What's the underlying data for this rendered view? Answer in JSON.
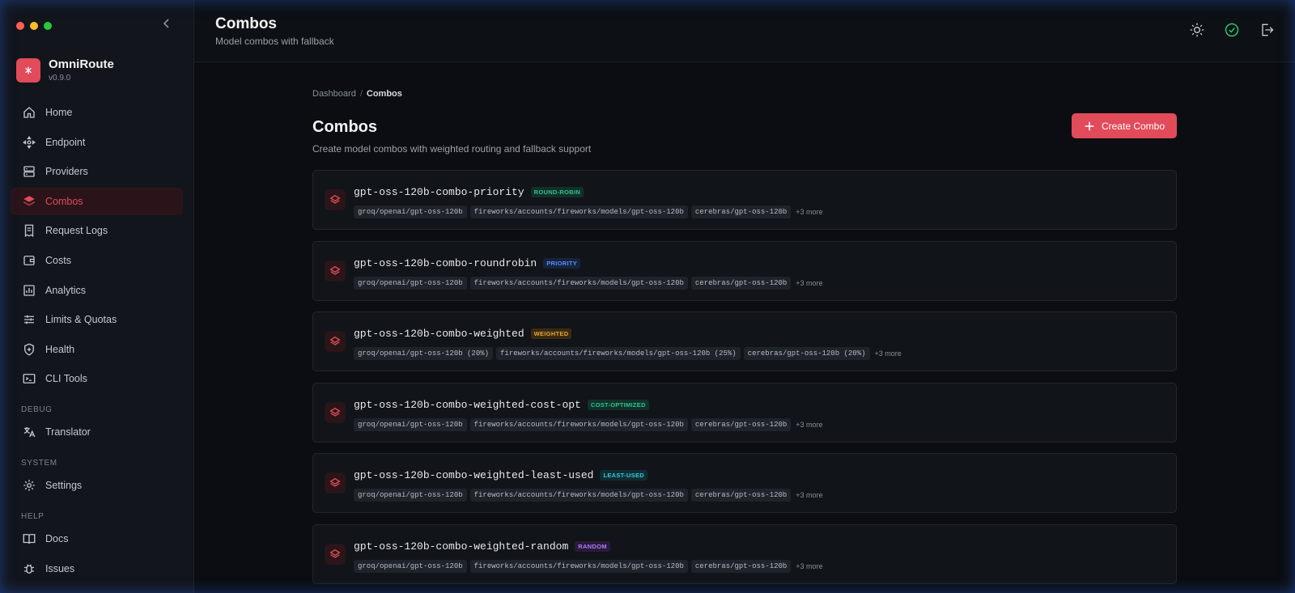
{
  "app": {
    "name": "OmniRoute",
    "version": "v0.9.0"
  },
  "colors": {
    "accent": "#e14b5a",
    "background": "#0b0d12",
    "sidebar": "#12151b"
  },
  "header": {
    "title": "Combos",
    "subtitle": "Model combos with fallback"
  },
  "nav": {
    "main": [
      {
        "label": "Home",
        "icon": "home-icon"
      },
      {
        "label": "Endpoint",
        "icon": "endpoint-icon"
      },
      {
        "label": "Providers",
        "icon": "server-icon"
      },
      {
        "label": "Combos",
        "icon": "layers-icon",
        "active": true
      },
      {
        "label": "Request Logs",
        "icon": "receipt-icon"
      },
      {
        "label": "Costs",
        "icon": "wallet-icon"
      },
      {
        "label": "Analytics",
        "icon": "chart-icon"
      },
      {
        "label": "Limits & Quotas",
        "icon": "sliders-icon"
      },
      {
        "label": "Health",
        "icon": "shield-icon"
      },
      {
        "label": "CLI Tools",
        "icon": "terminal-icon"
      }
    ],
    "debug_title": "DEBUG",
    "debug": [
      {
        "label": "Translator",
        "icon": "translate-icon"
      }
    ],
    "system_title": "SYSTEM",
    "system": [
      {
        "label": "Settings",
        "icon": "gear-icon"
      }
    ],
    "help_title": "HELP",
    "help": [
      {
        "label": "Docs",
        "icon": "book-icon"
      },
      {
        "label": "Issues",
        "icon": "bug-icon"
      }
    ]
  },
  "breadcrumb": {
    "parent": "Dashboard",
    "current": "Combos"
  },
  "page": {
    "title": "Combos",
    "subtitle": "Create model combos with weighted routing and fallback support",
    "create_button": "Create Combo"
  },
  "combos": [
    {
      "name": "gpt-oss-120b-combo-priority",
      "strategy": "ROUND-ROBIN",
      "badge_color": "#2fc48a",
      "badge_bg": "#12302a",
      "models": [
        "groq/openai/gpt-oss-120b",
        "fireworks/accounts/fireworks/models/gpt-oss-120b",
        "cerebras/gpt-oss-120b"
      ],
      "more": "+3 more"
    },
    {
      "name": "gpt-oss-120b-combo-roundrobin",
      "strategy": "PRIORITY",
      "badge_color": "#5b8def",
      "badge_bg": "#16233f",
      "models": [
        "groq/openai/gpt-oss-120b",
        "fireworks/accounts/fireworks/models/gpt-oss-120b",
        "cerebras/gpt-oss-120b"
      ],
      "more": "+3 more"
    },
    {
      "name": "gpt-oss-120b-combo-weighted",
      "strategy": "WEIGHTED",
      "badge_color": "#e3a53a",
      "badge_bg": "#3a2a12",
      "models": [
        "groq/openai/gpt-oss-120b (20%)",
        "fireworks/accounts/fireworks/models/gpt-oss-120b (25%)",
        "cerebras/gpt-oss-120b (20%)"
      ],
      "more": "+3 more"
    },
    {
      "name": "gpt-oss-120b-combo-weighted-cost-opt",
      "strategy": "COST-OPTIMIZED",
      "badge_color": "#2fc48a",
      "badge_bg": "#12302a",
      "models": [
        "groq/openai/gpt-oss-120b",
        "fireworks/accounts/fireworks/models/gpt-oss-120b",
        "cerebras/gpt-oss-120b"
      ],
      "more": "+3 more"
    },
    {
      "name": "gpt-oss-120b-combo-weighted-least-used",
      "strategy": "LEAST-USED",
      "badge_color": "#3fc6d6",
      "badge_bg": "#0f2d33",
      "models": [
        "groq/openai/gpt-oss-120b",
        "fireworks/accounts/fireworks/models/gpt-oss-120b",
        "cerebras/gpt-oss-120b"
      ],
      "more": "+3 more"
    },
    {
      "name": "gpt-oss-120b-combo-weighted-random",
      "strategy": "RANDOM",
      "badge_color": "#b07cf0",
      "badge_bg": "#2a1a3d",
      "models": [
        "groq/openai/gpt-oss-120b",
        "fireworks/accounts/fireworks/models/gpt-oss-120b",
        "cerebras/gpt-oss-120b"
      ],
      "more": "+3 more"
    }
  ]
}
